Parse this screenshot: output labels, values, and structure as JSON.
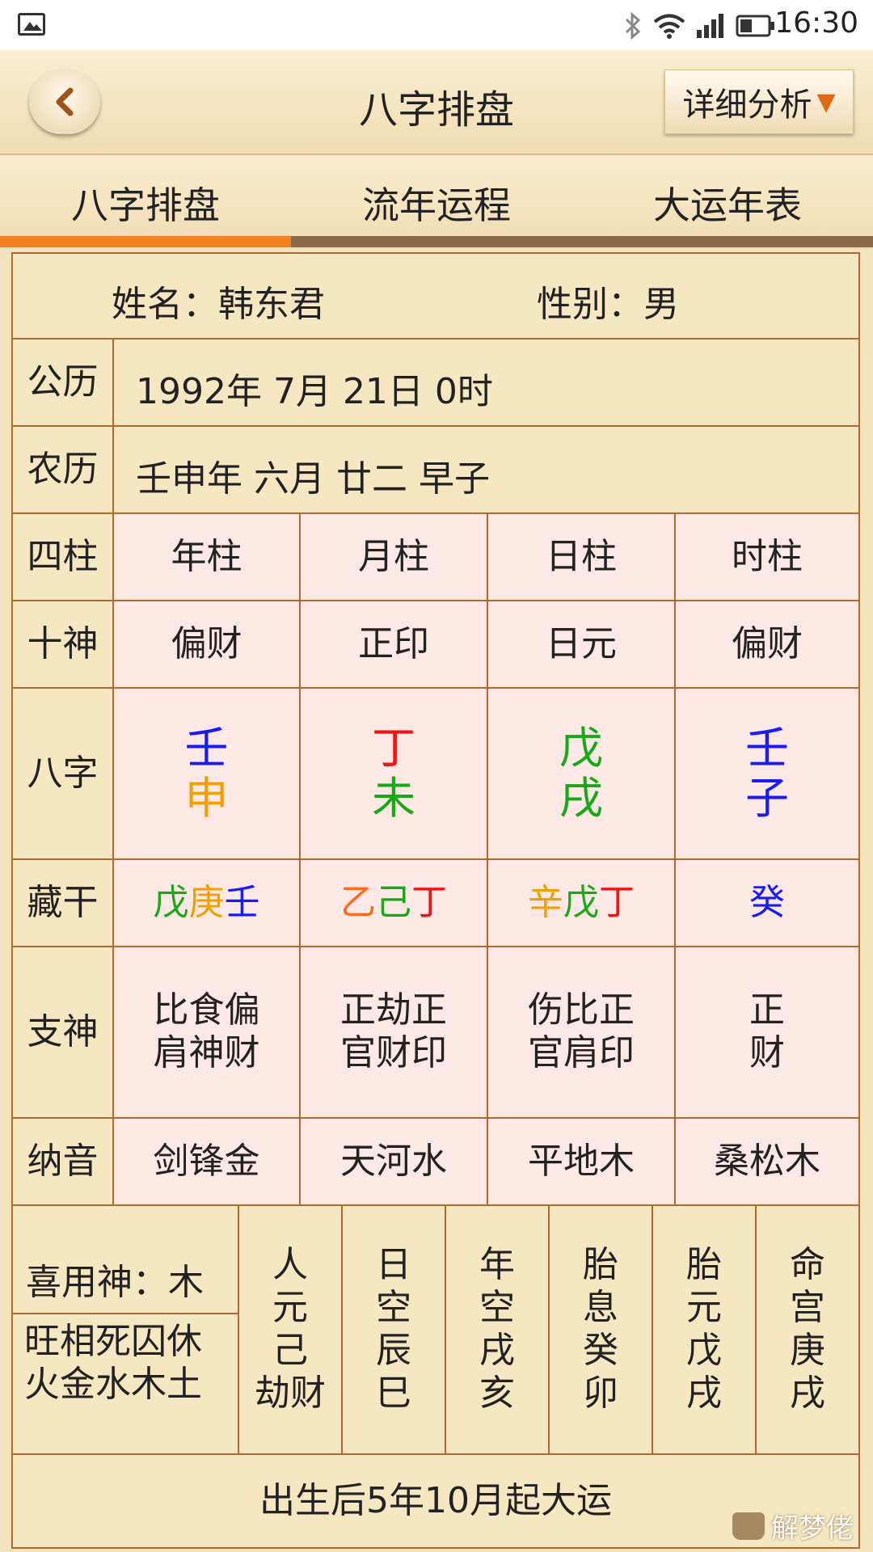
{
  "status_bar": {
    "time": "16:30"
  },
  "header": {
    "title": "八字排盘",
    "detail_label": "详细分析"
  },
  "tabs": [
    {
      "label": "八字排盘",
      "active": true
    },
    {
      "label": "流年运程",
      "active": false
    },
    {
      "label": "大运年表",
      "active": false
    }
  ],
  "info": {
    "name_line": "姓名：韩东君",
    "gender_line": "性别：男"
  },
  "calendar": {
    "solar_label": "公历",
    "solar_value": "1992年 7月 21日 0时",
    "lunar_label": "农历",
    "lunar_value": "壬申年 六月 廿二 早子"
  },
  "rows": {
    "pillars_label": "四柱",
    "pillars": [
      "年柱",
      "月柱",
      "日柱",
      "时柱"
    ],
    "shishen_label": "十神",
    "shishen": [
      "偏财",
      "正印",
      "日元",
      "偏财"
    ],
    "bazi_label": "八字",
    "bazi": [
      {
        "stem": "壬",
        "branch": "申"
      },
      {
        "stem": "丁",
        "branch": "未"
      },
      {
        "stem": "戊",
        "branch": "戌"
      },
      {
        "stem": "壬",
        "branch": "子"
      }
    ],
    "canggan_label": "藏干",
    "canggan": [
      [
        "戊",
        "庚",
        "壬"
      ],
      [
        "乙",
        "己",
        "丁"
      ],
      [
        "辛",
        "戊",
        "丁"
      ],
      [
        "癸"
      ]
    ],
    "zhishen_label": "支神",
    "zhishen": [
      [
        "比食偏",
        "肩神财"
      ],
      [
        "正劫正",
        "官财印"
      ],
      [
        "伤比正",
        "官肩印"
      ],
      [
        "正",
        "财"
      ]
    ],
    "nayin_label": "纳音",
    "nayin": [
      "剑锋金",
      "天河水",
      "平地木",
      "桑松木"
    ]
  },
  "bottom": {
    "xiyong": "喜用神：木",
    "wangxiang_1": "旺相死囚休",
    "wangxiang_2": "火金水木土",
    "columns": [
      [
        "人",
        "元",
        "己",
        "劫财"
      ],
      [
        "日",
        "空",
        "辰",
        "巳"
      ],
      [
        "年",
        "空",
        "戌",
        "亥"
      ],
      [
        "胎",
        "息",
        "癸",
        "卯"
      ],
      [
        "胎",
        "元",
        "戊",
        "戌"
      ],
      [
        "命",
        "宫",
        "庚",
        "戌"
      ]
    ],
    "dayun": "出生后5年10月起大运"
  },
  "watermark": "解梦佬",
  "colors": {
    "blue": "#1a1aff",
    "red": "#f01414",
    "green": "#18a818",
    "orange": "#f0a000",
    "light_orange": "#ff6a1a",
    "border": "#b16a2e",
    "pink_bg": "#fce8e4",
    "accent": "#f58220"
  },
  "icons": [
    "gallery-icon",
    "bluetooth-icon",
    "wifi-icon",
    "signal-icon",
    "battery-icon",
    "back-arrow-icon",
    "dropdown-arrow-icon"
  ]
}
